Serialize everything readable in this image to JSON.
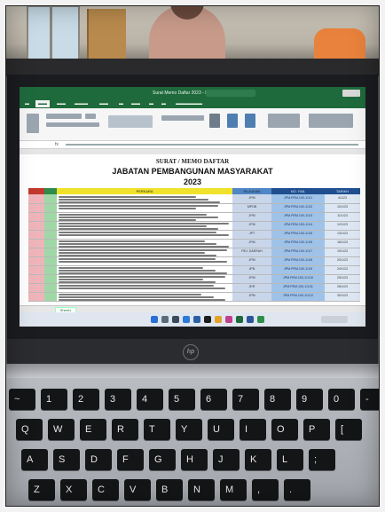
{
  "screen": {
    "doc_title": "SURAT / MEMO DAFTAR",
    "doc_subtitle": "JABATAN PEMBANGUNAN MASYARAKAT",
    "doc_year": "2023",
    "app_title": "Surat Memo Daftar 2023 - Excel",
    "sheet_tab": "Sheet1",
    "columns": {
      "description": "PERKARA",
      "reference": "RUJUKAN",
      "number": "NO. FAIL",
      "date": "TARIKH"
    },
    "rows": [
      {
        "ref": "JPM",
        "no": "JPM.PEM.100-1/1/1",
        "date": "4/1/23"
      },
      {
        "ref": "MPOB",
        "no": "JPM.PEM.100-1/1/2",
        "date": "10/1/23"
      },
      {
        "ref": "JPM",
        "no": "JPM.PEM.100-1/1/3",
        "date": "11/1/23"
      },
      {
        "ref": "JPM",
        "no": "JPM.PEM.100-1/1/4",
        "date": "12/1/23"
      },
      {
        "ref": "JPT",
        "no": "JPM.PEM.100-1/1/5",
        "date": "13/1/23"
      },
      {
        "ref": "JPM",
        "no": "JPM.PEM.100-1/1/6",
        "date": "18/1/23"
      },
      {
        "ref": "PEJ. DAERAH",
        "no": "JPM.PEM.100-1/1/7",
        "date": "19/1/23"
      },
      {
        "ref": "JPM",
        "no": "JPM.PEM.100-1/1/8",
        "date": "20/1/23"
      },
      {
        "ref": "JPN",
        "no": "JPM.PEM.100-1/1/9",
        "date": "24/1/23"
      },
      {
        "ref": "JPM",
        "no": "JPM.PEM.100-1/1/10",
        "date": "25/1/23"
      },
      {
        "ref": "JKR",
        "no": "JPM.PEM.100-1/1/11",
        "date": "26/1/23"
      },
      {
        "ref": "JPM",
        "no": "JPM.PEM.100-1/1/12",
        "date": "30/1/23"
      }
    ]
  },
  "laptop": {
    "logo": "hp",
    "keyboard_rows": [
      [
        "~",
        "1",
        "2",
        "3",
        "4",
        "5",
        "6",
        "7",
        "8",
        "9",
        "0",
        "-"
      ],
      [
        "Q",
        "W",
        "E",
        "R",
        "T",
        "Y",
        "U",
        "I",
        "O",
        "P",
        "["
      ],
      [
        "A",
        "S",
        "D",
        "F",
        "G",
        "H",
        "J",
        "K",
        "L",
        ";"
      ],
      [
        "Z",
        "X",
        "C",
        "V",
        "B",
        "N",
        "M",
        ",",
        "."
      ]
    ]
  },
  "colors": {
    "excel_green": "#1f6a3c",
    "header_red": "#c0392b",
    "header_yellow": "#f0e22a",
    "header_blue": "#1f4f8f"
  }
}
